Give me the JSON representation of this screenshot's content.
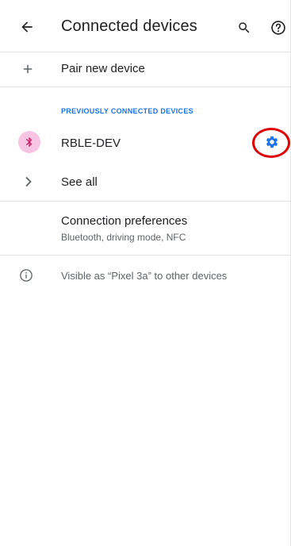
{
  "appbar": {
    "title": "Connected devices",
    "back_icon": "arrow-back-icon",
    "search_icon": "search-icon",
    "help_icon": "help-circle-icon"
  },
  "pair_new": {
    "label": "Pair new device",
    "icon": "plus-icon"
  },
  "previously_connected": {
    "header": "PREVIOUSLY CONNECTED DEVICES",
    "devices": [
      {
        "name": "RBLE-DEV",
        "icon": "bluetooth-icon",
        "settings_icon": "gear-icon"
      }
    ],
    "see_all_label": "See all"
  },
  "connection_preferences": {
    "title": "Connection preferences",
    "summary": "Bluetooth, driving mode, NFC"
  },
  "footer_info": {
    "text": "Visible as “Pixel 3a” to other devices",
    "icon": "info-icon"
  },
  "colors": {
    "accent": "#1a73e8",
    "bluetooth_icon": "#c2185b",
    "bluetooth_bg": "#f8c4e4",
    "highlight_ring": "#e00000"
  }
}
